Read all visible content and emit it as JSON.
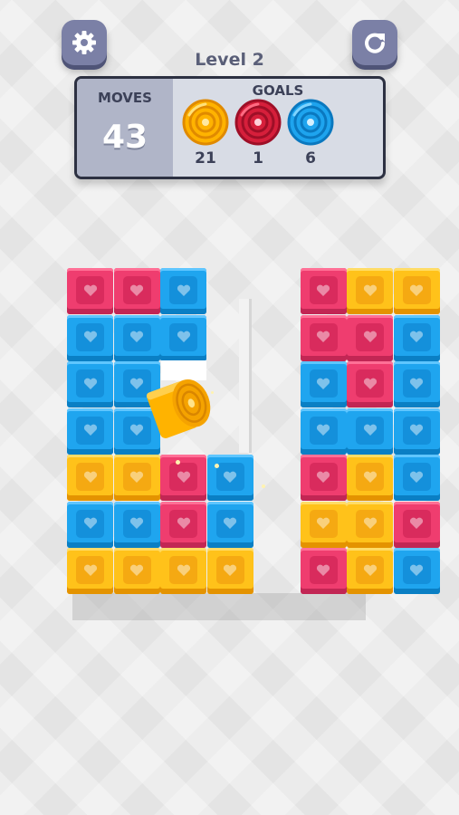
{
  "level_title": "Level 2",
  "moves": {
    "label": "MOVES",
    "value": "43"
  },
  "goals": {
    "label": "GOALS",
    "items": [
      {
        "color": "yellow",
        "count": "21"
      },
      {
        "color": "red",
        "count": "1"
      },
      {
        "color": "blue",
        "count": "6"
      }
    ]
  },
  "buttons": {
    "settings_icon": "gear-icon",
    "restart_icon": "restart-icon"
  },
  "colors": {
    "pink": "#ef3d6f",
    "blue": "#1fa5ef",
    "yellow": "#ffc21a",
    "panel_border": "#2d3142"
  },
  "board": {
    "rows": [
      [
        "pink",
        "pink",
        "blue",
        null,
        null,
        "pink",
        "yellow",
        "yellow"
      ],
      [
        "blue",
        "blue",
        "blue",
        null,
        null,
        "pink",
        "pink",
        "blue"
      ],
      [
        "blue",
        "blue",
        "empty",
        null,
        null,
        "blue",
        "pink",
        "blue"
      ],
      [
        "blue",
        "blue",
        null,
        null,
        null,
        "blue",
        "blue",
        "blue"
      ],
      [
        "yellow",
        "yellow",
        "pink",
        "blue",
        null,
        "pink",
        "yellow",
        "blue"
      ],
      [
        "blue",
        "blue",
        "pink",
        "blue",
        null,
        "yellow",
        "yellow",
        "pink"
      ],
      [
        "yellow",
        "yellow",
        "yellow",
        "yellow",
        null,
        "pink",
        "yellow",
        "blue"
      ]
    ]
  }
}
